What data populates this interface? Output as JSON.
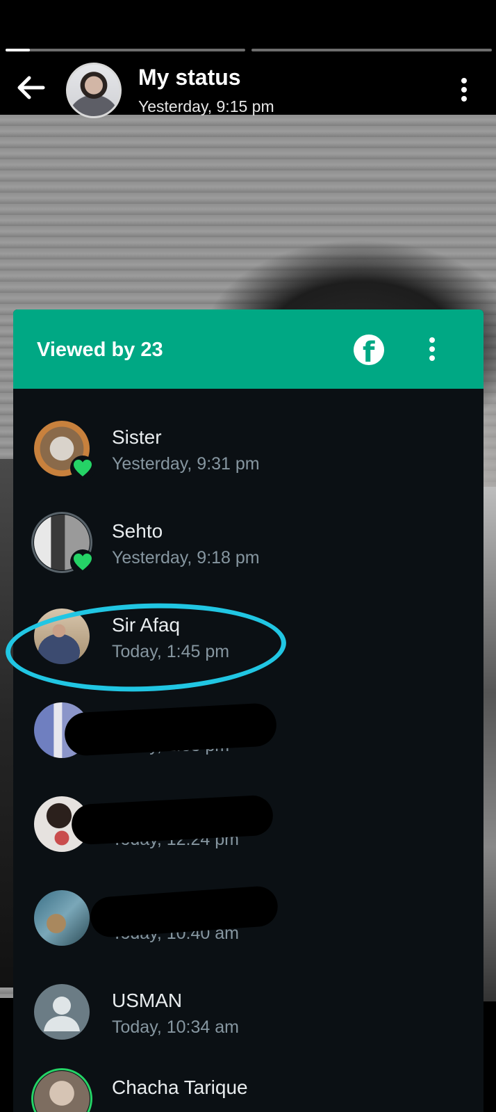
{
  "header": {
    "title": "My status",
    "subtitle": "Yesterday, 9:15 pm",
    "progress_segments": [
      {
        "fill_fraction": 0.1
      },
      {
        "fill_fraction": 0
      }
    ]
  },
  "viewers": {
    "title": "Viewed by 23",
    "list": [
      {
        "name": "Sister",
        "time": "Yesterday, 9:31 pm",
        "liked": true
      },
      {
        "name": "Sehto",
        "time": "Yesterday, 9:18 pm",
        "liked": true
      },
      {
        "name": "Sir Afaq",
        "time": "Today, 1:45 pm",
        "liked": false
      },
      {
        "name": "",
        "time": "Today, 1:33 pm",
        "liked": false
      },
      {
        "name": "",
        "time": "Today, 12:24 pm",
        "liked": false
      },
      {
        "name": "",
        "time": "Today, 10:40 am",
        "liked": false
      },
      {
        "name": "USMAN",
        "time": "Today, 10:34 am",
        "liked": false
      },
      {
        "name": "Chacha Tarique",
        "time": "",
        "liked": false
      }
    ]
  },
  "colors": {
    "accent": "#00a884",
    "like": "#25d366",
    "highlight_circle": "#21c6e3"
  },
  "icons": [
    "back-arrow-icon",
    "more-options-icon",
    "facebook-icon",
    "heart-icon",
    "default-avatar-icon"
  ]
}
